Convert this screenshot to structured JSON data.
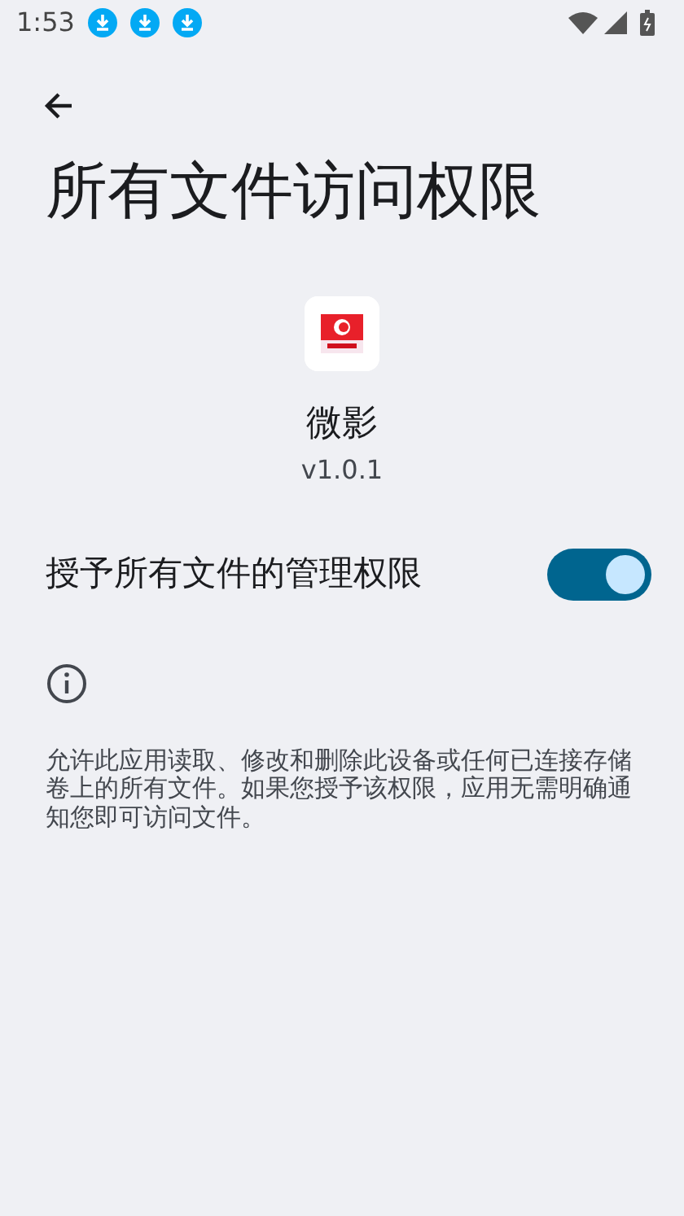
{
  "status_bar": {
    "time": "1:53",
    "notifications": [
      {
        "kind": "download"
      },
      {
        "kind": "download"
      },
      {
        "kind": "download"
      }
    ]
  },
  "title": "所有文件访问权限",
  "app": {
    "name": "微影",
    "version": "v1.0.1"
  },
  "setting": {
    "label": "授予所有文件的管理权限",
    "on": true
  },
  "description": "允许此应用读取、修改和删除此设备或任何已连接存储卷上的所有文件。如果您授予该权限，应用无需明确通知您即可访问文件。"
}
